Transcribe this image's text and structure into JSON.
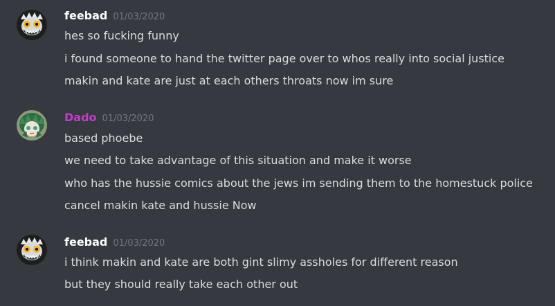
{
  "groups": [
    {
      "username": "feebad",
      "username_color": "#ffffff",
      "timestamp": "01/03/2020",
      "avatar_icon": "skull-grin-avatar",
      "lines": [
        "hes so fucking funny",
        "i found someone to hand the twitter page over to whos really into social justice",
        "makin and kate are just at each others throats now im sure"
      ]
    },
    {
      "username": "Dado",
      "username_color": "#c13ec7",
      "timestamp": "01/03/2020",
      "avatar_icon": "green-haired-character-avatar",
      "lines": [
        "based phoebe",
        "we need to take advantage of this situation and make it worse",
        "who has the hussie comics about the jews im sending them to the homestuck police",
        "cancel makin kate and hussie Now"
      ]
    },
    {
      "username": "feebad",
      "username_color": "#ffffff",
      "timestamp": "01/03/2020",
      "avatar_icon": "skull-grin-avatar",
      "lines": [
        "i think makin and kate are both gint slimy assholes for different reason",
        "but they should really take each other out"
      ]
    }
  ],
  "colors": {
    "background": "#36393f",
    "text": "#dcddde",
    "timestamp": "#72767d"
  }
}
